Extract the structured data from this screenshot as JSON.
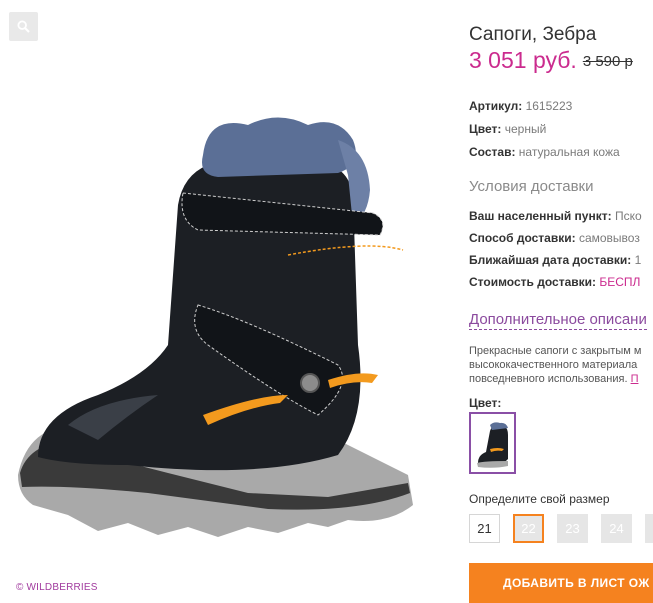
{
  "product": {
    "title": "Сапоги, Зебра",
    "price": "3 051 руб.",
    "old_price": "3 590 р"
  },
  "props": [
    {
      "label": "Артикул:",
      "value": "1615223"
    },
    {
      "label": "Цвет:",
      "value": "черный"
    },
    {
      "label": "Состав:",
      "value": "натуральная кожа"
    }
  ],
  "delivery": {
    "title": "Условия доставки",
    "rows": [
      {
        "label": "Ваш населенный пункт:",
        "value": "Пско"
      },
      {
        "label": "Способ доставки:",
        "value": "самовывоз"
      },
      {
        "label": "Ближайшая дата доставки:",
        "value": "1"
      },
      {
        "label": "Стоимость доставки:",
        "value": "БЕСПЛ"
      }
    ]
  },
  "description": {
    "link_label": "Дополнительное описани",
    "lines": [
      "Прекрасные сапоги с закрытым м",
      "высококачественного материала",
      "повседневного использования."
    ],
    "more": "П"
  },
  "color_section": {
    "label": "Цвет:"
  },
  "sizes": {
    "label": "Определите свой размер",
    "items": [
      {
        "value": "21",
        "state": "available"
      },
      {
        "value": "22",
        "state": "selected"
      },
      {
        "value": "23",
        "state": "unavailable"
      },
      {
        "value": "24",
        "state": "unavailable"
      }
    ]
  },
  "cart_button": "ДОБАВИТЬ В ЛИСТ ОЖ",
  "watermark": "© WILDBERRIES",
  "icons": {
    "zoom": "search-icon"
  },
  "colors": {
    "accent": "#f5821f",
    "price": "#cb2b8e",
    "link": "#8b4a9e"
  }
}
